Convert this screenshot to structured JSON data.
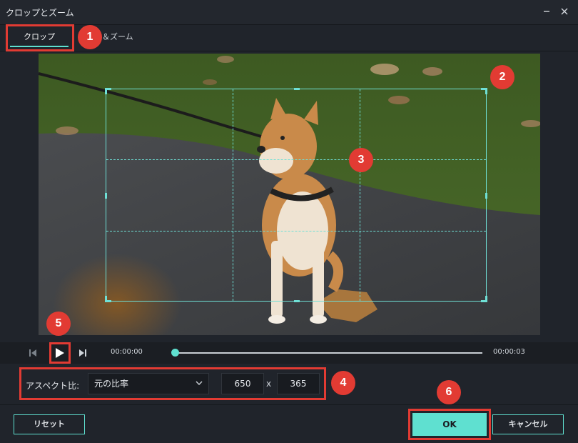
{
  "window": {
    "title": "クロップとズーム",
    "minimize_icon": "minimize-icon",
    "close_icon": "close-icon"
  },
  "tabs": [
    {
      "label": "クロップ",
      "active": true
    },
    {
      "label": "パン＆ズーム",
      "visible_part": "ン＆ズーム",
      "active": false
    }
  ],
  "preview": {
    "description_icon": "image-preview",
    "accent_color": "#6fe0d6"
  },
  "playback": {
    "prev_icon": "prev-frame-icon",
    "play_icon": "play-icon",
    "next_icon": "next-frame-icon",
    "current_time": "00:00:00",
    "end_time": "00:00:03",
    "progress": 0
  },
  "aspect": {
    "label": "アスペクト比:",
    "selected": "元の比率",
    "width": "650",
    "separator": "x",
    "height": "365"
  },
  "buttons": {
    "reset": "リセット",
    "ok": "OK",
    "cancel": "キャンセル"
  },
  "annotations": [
    "1",
    "2",
    "3",
    "4",
    "5",
    "6"
  ],
  "colors": {
    "accent": "#5fe0d0",
    "annotation": "#e23b33",
    "background": "#20242b"
  }
}
